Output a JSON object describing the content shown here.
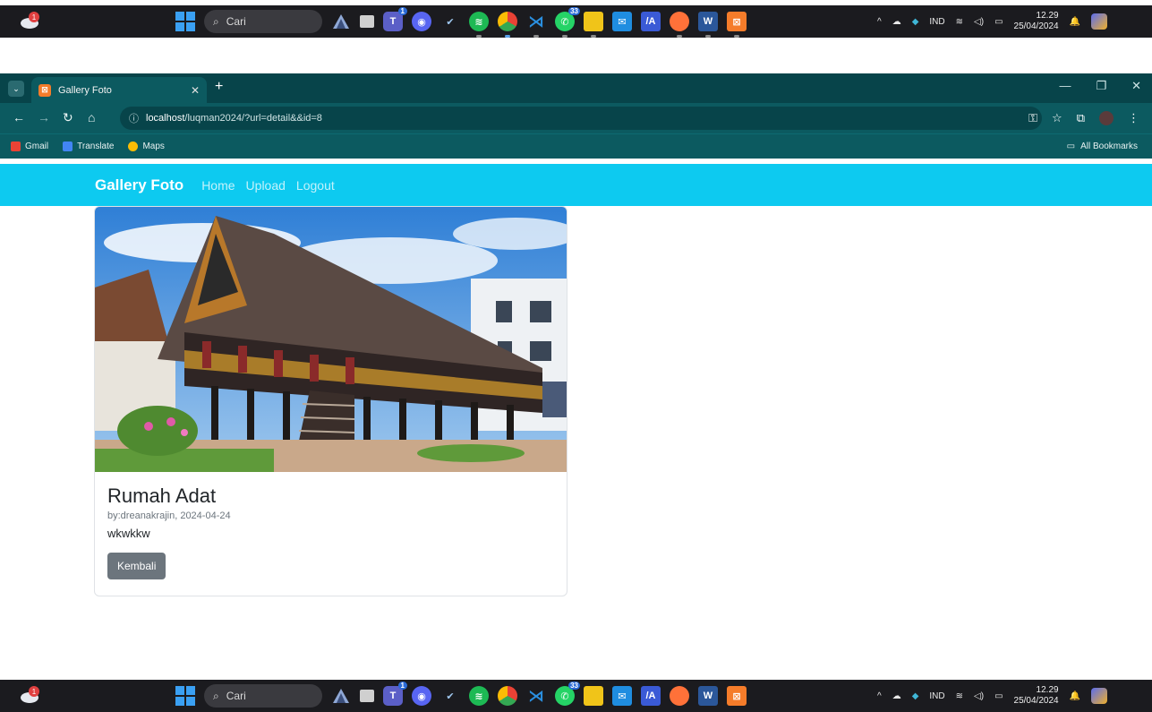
{
  "taskbar": {
    "search_placeholder": "Cari",
    "lang": "IND",
    "time": "12.29",
    "date": "25/04/2024",
    "weather_badge": "1",
    "teams_badge": "1",
    "whatsapp_badge": "33",
    "apps": [
      {
        "name": "explorer-triangle-icon",
        "color": "#7a98c9"
      },
      {
        "name": "taskview-icon",
        "color": "#cccccc"
      },
      {
        "name": "teams-icon",
        "color": "#5b5fc7"
      },
      {
        "name": "discord-icon",
        "color": "#5865f2"
      },
      {
        "name": "steam-icon",
        "color": "#2f6fb0"
      },
      {
        "name": "spotify-icon",
        "color": "#1db954"
      },
      {
        "name": "chrome-icon",
        "color": "#e0a43a"
      },
      {
        "name": "vscode-icon",
        "color": "#2a8fe0"
      },
      {
        "name": "whatsapp-icon",
        "color": "#25d366"
      },
      {
        "name": "files-icon",
        "color": "#f0c419"
      },
      {
        "name": "mail-icon",
        "color": "#1f8de0"
      },
      {
        "name": "pixel-editor-icon",
        "color": "#3a5ad6"
      },
      {
        "name": "firefox-icon",
        "color": "#ff7139"
      },
      {
        "name": "word-icon",
        "color": "#2b579a"
      },
      {
        "name": "xampp-icon",
        "color": "#f57c2a"
      }
    ]
  },
  "browser": {
    "tab_title": "Gallery Foto",
    "url_host": "localhost",
    "url_path": "/luqman2024/?url=detail&&id=8",
    "bookmarks": [
      "Gmail",
      "Translate",
      "Maps"
    ],
    "all_bookmarks": "All Bookmarks",
    "colors": {
      "frame": "#07444a",
      "toolbar": "#0c5a60"
    }
  },
  "site": {
    "brand": "Gallery Foto",
    "nav": [
      "Home",
      "Upload",
      "Logout"
    ],
    "colors": {
      "navbar": "#0dcaf0",
      "button": "#6c757d"
    }
  },
  "photo": {
    "title": "Rumah Adat",
    "meta": "by:dreanakrajin, 2024-04-24",
    "description": "wkwkkw",
    "back_label": "Kembali"
  }
}
